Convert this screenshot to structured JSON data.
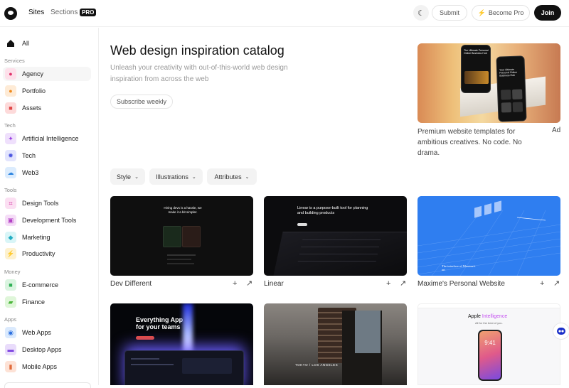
{
  "topbar": {
    "nav_sites": "Sites",
    "nav_sections": "Sections",
    "pro_badge": "PRO",
    "submit": "Submit",
    "become_pro": "Become Pro",
    "join": "Join"
  },
  "sidebar": {
    "all": "All",
    "groups": {
      "services": "Services",
      "tech": "Tech",
      "tools": "Tools",
      "money": "Money",
      "apps": "Apps"
    },
    "items": {
      "agency": "Agency",
      "portfolio": "Portfolio",
      "assets": "Assets",
      "ai": "Artificial Intelligence",
      "tech": "Tech",
      "web3": "Web3",
      "design_tools": "Design Tools",
      "development_tools": "Development Tools",
      "marketing": "Marketing",
      "productivity": "Productivity",
      "ecommerce": "E-commerce",
      "finance": "Finance",
      "web_apps": "Web Apps",
      "desktop_apps": "Desktop Apps",
      "mobile_apps": "Mobile Apps"
    },
    "active_item": "Agency"
  },
  "hero": {
    "title": "Web design inspiration catalog",
    "subtitle": "Unleash your creativity with out-of-this-world web design inspiration from across the web",
    "subscribe": "Subscribe weekly"
  },
  "ad": {
    "phone_text_1": "The Ultimate Personal Online Business Hub",
    "phone_text_2": "Your Ultimate Personal Online Business Hub",
    "text": "Premium website templates for ambitious creatives. No code. No drama.",
    "label": "Ad"
  },
  "filters": {
    "style": "Style",
    "illustrations": "Illustrations",
    "attributes": "Attributes"
  },
  "cards": {
    "c1": {
      "title": "Dev Different",
      "shot_heading": "Hiring devs is a hassle, we make it a bit simpler."
    },
    "c2": {
      "title": "Linear",
      "shot_heading": "Linear is a purpose-built tool for planning and building products"
    },
    "c3": {
      "title": "Maxime's Personal Website",
      "shot_text": "The interface of Maxime's art"
    },
    "c4": {
      "shot_heading": "Everything App for your teams"
    },
    "c5": {
      "shot_text": "TOKYO / LOS ANGELES"
    },
    "c6": {
      "shot_heading_1": "Apple",
      "shot_heading_2": "Intelligence",
      "shot_sub": "All for the best of you.",
      "shot_time": "9:41"
    }
  },
  "colors": {
    "accent_dark": "#111111",
    "sidebar_active_bg": "#f6f6f6",
    "filter_bg": "#f3f3f3",
    "maxime_blue": "#2f7ef0",
    "chat_icon": "#1a2fc9"
  },
  "icons": {
    "theme": "moon-icon",
    "become_pro": "lightning-icon",
    "card_add": "plus-icon",
    "card_open": "arrow-up-right-icon",
    "filter": "chevron-down-icon",
    "chat": "chat-bot-icon"
  }
}
